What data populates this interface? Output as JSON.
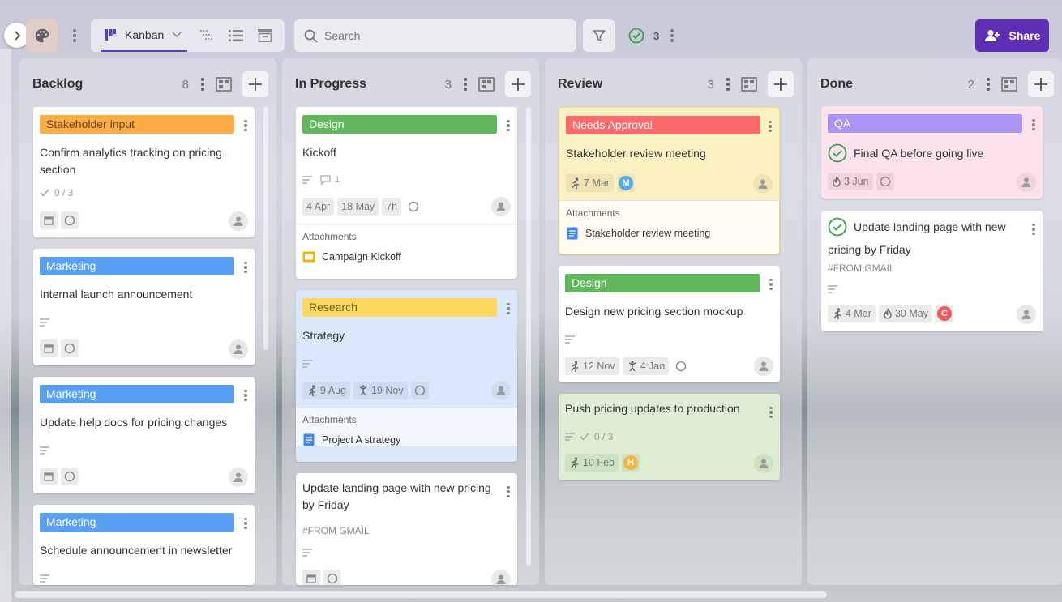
{
  "toolbar": {
    "view_label": "Kanban",
    "search_placeholder": "Search",
    "done_count": "3",
    "share_label": "Share"
  },
  "colors": {
    "accent": "#5e2fb5",
    "orange": "#ffac45",
    "blue": "#59a0f5",
    "green": "#62b85c",
    "yellow": "#fcd95c",
    "red": "#fb6b6e",
    "purple": "#ab95f7"
  },
  "columns": [
    {
      "name": "Backlog",
      "count": "8",
      "cards": [
        {
          "tag": "Stakeholder input",
          "title_l1": "Confirm analytics tracking on pricing",
          "title_l2": "section",
          "checklist": "0 / 3"
        },
        {
          "tag": "Marketing",
          "title_l1": "Internal launch announcement"
        },
        {
          "tag": "Marketing",
          "title_l1": "Update help docs for pricing changes"
        },
        {
          "tag": "Marketing",
          "title_l1": "Schedule announcement in newsletter"
        }
      ]
    },
    {
      "name": "In Progress",
      "count": "3",
      "cards": [
        {
          "tag": "Design",
          "title_l1": "Kickoff",
          "comments": "1",
          "start": "4 Apr",
          "end": "18 May",
          "estimate": "7h",
          "attachments_label": "Attachments",
          "file": "Campaign Kickoff"
        },
        {
          "tag": "Research",
          "title_l1": "Strategy",
          "start": "9 Aug",
          "end": "19 Nov",
          "attachments_label": "Attachments",
          "file": "Project A strategy"
        },
        {
          "title_l1": "Update landing page with new pricing",
          "title_l2": "by Friday",
          "source": "#FROM GMAIL"
        }
      ]
    },
    {
      "name": "Review",
      "count": "3",
      "cards": [
        {
          "tag": "Needs Approval",
          "title_l1": "Stakeholder review meeting",
          "start": "7 Mar",
          "member": "M",
          "attachments_label": "Attachments",
          "file": "Stakeholder review meeting"
        },
        {
          "tag": "Design",
          "title_l1": "Design new pricing section mockup",
          "start": "12 Nov",
          "end": "4 Jan"
        },
        {
          "title_l1": "Push pricing updates to production",
          "checklist": "0 / 3",
          "start": "10 Feb",
          "member": "H"
        }
      ]
    },
    {
      "name": "Done",
      "count": "2",
      "cards": [
        {
          "tag": "QA",
          "title_l1": "Final QA before going live",
          "due": "3 Jun"
        },
        {
          "title_l1": "Update landing page with new",
          "title_l2": "pricing by Friday",
          "source": "#FROM GMAIL",
          "start": "4 Mar",
          "due": "30 May",
          "member": "C"
        }
      ]
    }
  ]
}
